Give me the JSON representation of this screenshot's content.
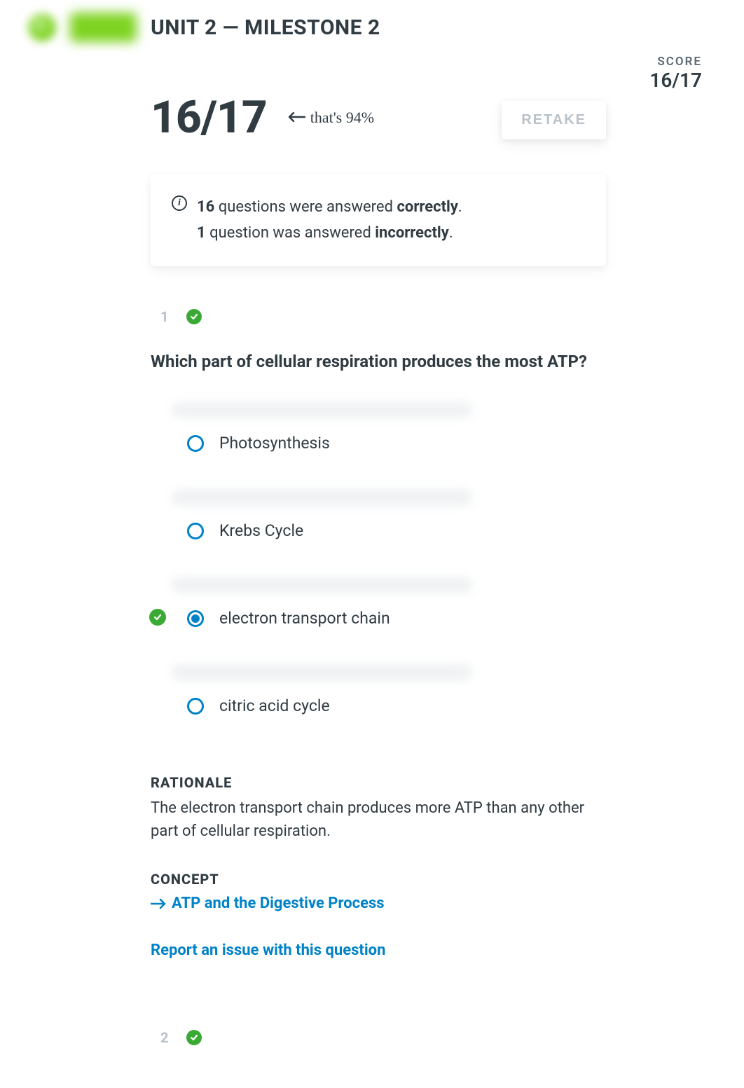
{
  "header": {
    "title": "UNIT 2 — MILESTONE 2"
  },
  "score": {
    "label": "SCORE",
    "value": "16/17",
    "big": "16/17",
    "percent_note": "that's 94%"
  },
  "retake_label": "RETAKE",
  "summary": {
    "correct_count": "16",
    "correct_text_after": " questions were answered ",
    "correct_word": "correctly",
    "incorrect_count": "1",
    "incorrect_text_after": " question was answered ",
    "incorrect_word": "incorrectly"
  },
  "question1": {
    "number": "1",
    "text": "Which part of cellular respiration produces the most ATP?",
    "options": [
      {
        "label": "Photosynthesis",
        "selected": false,
        "correct": false
      },
      {
        "label": "Krebs Cycle",
        "selected": false,
        "correct": false
      },
      {
        "label": "electron transport chain",
        "selected": true,
        "correct": true
      },
      {
        "label": "citric acid cycle",
        "selected": false,
        "correct": false
      }
    ],
    "rationale_head": "RATIONALE",
    "rationale_text": "The electron transport chain produces more ATP than any other part of cellular respiration.",
    "concept_head": "CONCEPT",
    "concept_link": "ATP and the Digestive Process",
    "report_link": "Report an issue with this question"
  },
  "question2": {
    "number": "2"
  }
}
